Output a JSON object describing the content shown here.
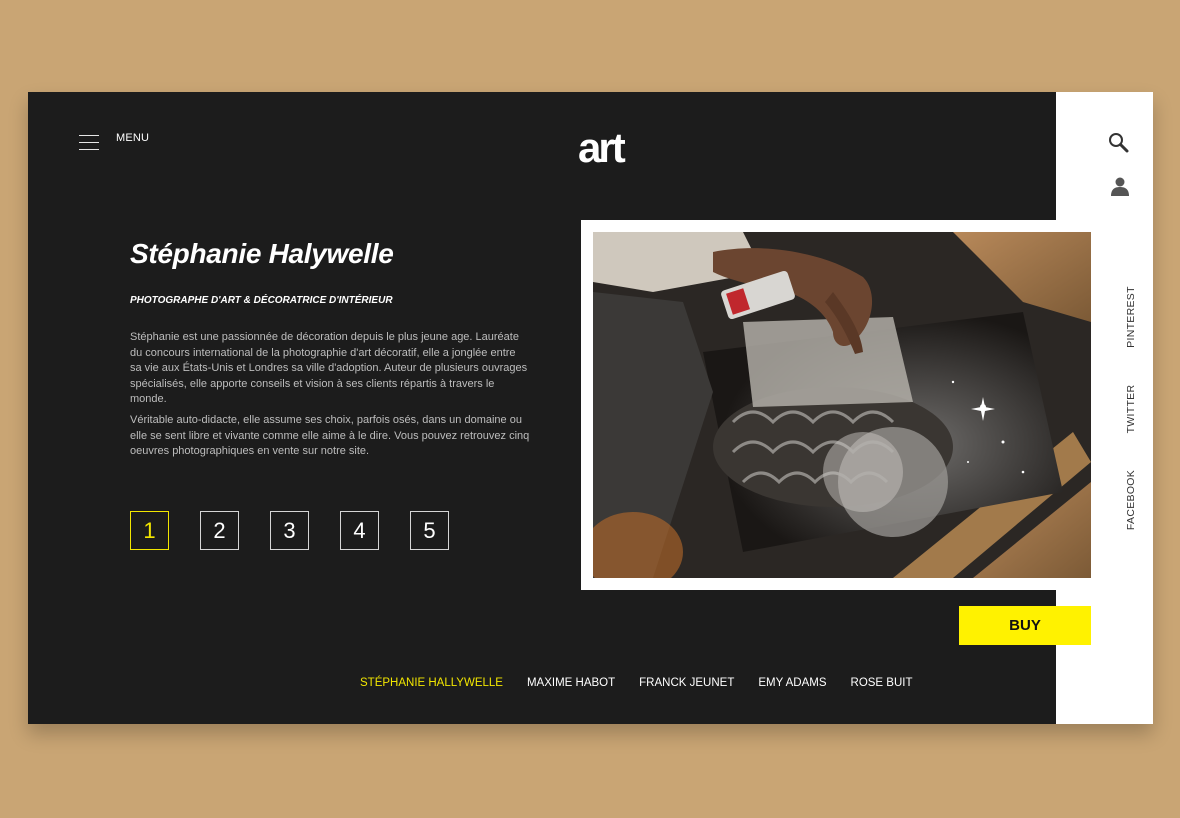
{
  "header": {
    "menu_label": "MENU",
    "logo": "art"
  },
  "artist": {
    "name": "Stéphanie Halywelle",
    "subtitle": "PHOTOGRAPHE D'ART & DÉCORATRICE D'INTÉRIEUR",
    "bio": [
      "Stéphanie est une passionnée de décoration depuis le plus jeune age. Lauréate du concours international de la photographie d'art décoratif, elle a jonglée entre sa vie aux États-Unis et Londres sa ville d'adoption. Auteur de plusieurs ouvrages spécialisés, elle apporte conseils et vision à ses clients répartis à travers le monde.",
      "Véritable auto-didacte, elle assume ses choix, parfois osés, dans un domaine ou elle se sent libre et vivante comme elle aime à le dire. Vous pouvez retrouvez cinq oeuvres photographiques en vente sur notre site."
    ]
  },
  "pager": {
    "pages": [
      "1",
      "2",
      "3",
      "4",
      "5"
    ],
    "active": "1"
  },
  "buy_label": "BUY",
  "artists": [
    {
      "label": "STÉPHANIE HALLYWELLE",
      "active": true
    },
    {
      "label": "MAXIME HABOT",
      "active": false
    },
    {
      "label": "FRANCK JEUNET",
      "active": false
    },
    {
      "label": "EMY ADAMS",
      "active": false
    },
    {
      "label": "ROSE BUIT",
      "active": false
    }
  ],
  "social": {
    "pinterest": "PINTEREST",
    "twitter": "TWITTER",
    "facebook": "FACEBOOK"
  },
  "icons": {
    "search": "search-icon",
    "user": "user-icon",
    "menu": "hamburger-icon"
  },
  "colors": {
    "background": "#c9a574",
    "panel": "#1c1c1c",
    "accent": "#fff200",
    "active_text": "#f2e600"
  }
}
